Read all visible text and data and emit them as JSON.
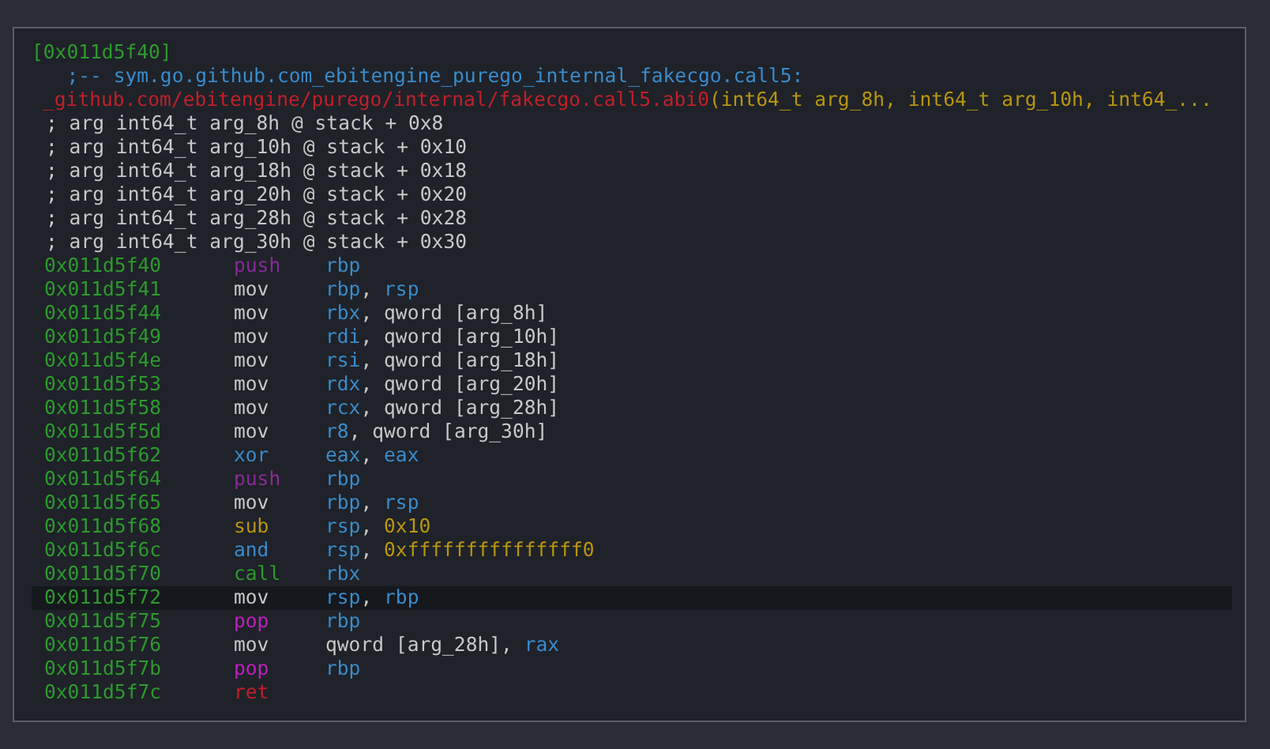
{
  "header": {
    "address": "[0x011d5f40]",
    "symbol_line": [
      {
        "text": "   ;-- sym.go.github.com_ebitengine_purego_internal_fakecgo.call5:",
        "kind": "flag"
      }
    ],
    "signature_line": [
      {
        "text": "_github.com/ebitengine/purego/internal/fakecgo.call5.abi0",
        "kind": "func"
      },
      {
        "text": "(int64_t arg_8h, int64_t arg_10h, int64_...",
        "kind": "args"
      }
    ]
  },
  "arg_comments": [
    "; arg int64_t arg_8h @ stack + 0x8",
    "; arg int64_t arg_10h @ stack + 0x10",
    "; arg int64_t arg_18h @ stack + 0x18",
    "; arg int64_t arg_20h @ stack + 0x20",
    "; arg int64_t arg_28h @ stack + 0x28",
    "; arg int64_t arg_30h @ stack + 0x30"
  ],
  "instructions": [
    {
      "address": "0x011d5f40",
      "mnemonic": "push",
      "kind": "push",
      "selected": false,
      "operands": [
        {
          "text": "rbp",
          "kind": "reg"
        }
      ]
    },
    {
      "address": "0x011d5f41",
      "mnemonic": "mov",
      "kind": "mov",
      "selected": false,
      "operands": [
        {
          "text": "rbp",
          "kind": "reg"
        },
        {
          "text": ", ",
          "kind": "plain"
        },
        {
          "text": "rsp",
          "kind": "reg"
        }
      ]
    },
    {
      "address": "0x011d5f44",
      "mnemonic": "mov",
      "kind": "mov",
      "selected": false,
      "operands": [
        {
          "text": "rbx",
          "kind": "reg"
        },
        {
          "text": ", qword [arg_8h]",
          "kind": "plain"
        }
      ]
    },
    {
      "address": "0x011d5f49",
      "mnemonic": "mov",
      "kind": "mov",
      "selected": false,
      "operands": [
        {
          "text": "rdi",
          "kind": "reg"
        },
        {
          "text": ", qword [arg_10h]",
          "kind": "plain"
        }
      ]
    },
    {
      "address": "0x011d5f4e",
      "mnemonic": "mov",
      "kind": "mov",
      "selected": false,
      "operands": [
        {
          "text": "rsi",
          "kind": "reg"
        },
        {
          "text": ", qword [arg_18h]",
          "kind": "plain"
        }
      ]
    },
    {
      "address": "0x011d5f53",
      "mnemonic": "mov",
      "kind": "mov",
      "selected": false,
      "operands": [
        {
          "text": "rdx",
          "kind": "reg"
        },
        {
          "text": ", qword [arg_20h]",
          "kind": "plain"
        }
      ]
    },
    {
      "address": "0x011d5f58",
      "mnemonic": "mov",
      "kind": "mov",
      "selected": false,
      "operands": [
        {
          "text": "rcx",
          "kind": "reg"
        },
        {
          "text": ", qword [arg_28h]",
          "kind": "plain"
        }
      ]
    },
    {
      "address": "0x011d5f5d",
      "mnemonic": "mov",
      "kind": "mov",
      "selected": false,
      "operands": [
        {
          "text": "r8",
          "kind": "reg"
        },
        {
          "text": ", qword [arg_30h]",
          "kind": "plain"
        }
      ]
    },
    {
      "address": "0x011d5f62",
      "mnemonic": "xor",
      "kind": "logic",
      "selected": false,
      "operands": [
        {
          "text": "eax",
          "kind": "reg"
        },
        {
          "text": ", ",
          "kind": "plain"
        },
        {
          "text": "eax",
          "kind": "reg"
        }
      ]
    },
    {
      "address": "0x011d5f64",
      "mnemonic": "push",
      "kind": "push",
      "selected": false,
      "operands": [
        {
          "text": "rbp",
          "kind": "reg"
        }
      ]
    },
    {
      "address": "0x011d5f65",
      "mnemonic": "mov",
      "kind": "mov",
      "selected": false,
      "operands": [
        {
          "text": "rbp",
          "kind": "reg"
        },
        {
          "text": ", ",
          "kind": "plain"
        },
        {
          "text": "rsp",
          "kind": "reg"
        }
      ]
    },
    {
      "address": "0x011d5f68",
      "mnemonic": "sub",
      "kind": "math",
      "selected": false,
      "operands": [
        {
          "text": "rsp",
          "kind": "reg"
        },
        {
          "text": ", ",
          "kind": "plain"
        },
        {
          "text": "0x10",
          "kind": "num"
        }
      ]
    },
    {
      "address": "0x011d5f6c",
      "mnemonic": "and",
      "kind": "logic",
      "selected": false,
      "operands": [
        {
          "text": "rsp",
          "kind": "reg"
        },
        {
          "text": ", ",
          "kind": "plain"
        },
        {
          "text": "0xfffffffffffffff0",
          "kind": "num"
        }
      ]
    },
    {
      "address": "0x011d5f70",
      "mnemonic": "call",
      "kind": "call",
      "selected": false,
      "operands": [
        {
          "text": "rbx",
          "kind": "reg"
        }
      ]
    },
    {
      "address": "0x011d5f72",
      "mnemonic": "mov",
      "kind": "mov",
      "selected": true,
      "operands": [
        {
          "text": "rsp",
          "kind": "reg"
        },
        {
          "text": ", ",
          "kind": "plain"
        },
        {
          "text": "rbp",
          "kind": "reg"
        }
      ]
    },
    {
      "address": "0x011d5f75",
      "mnemonic": "pop",
      "kind": "pop",
      "selected": false,
      "operands": [
        {
          "text": "rbp",
          "kind": "reg"
        }
      ]
    },
    {
      "address": "0x011d5f76",
      "mnemonic": "mov",
      "kind": "mov",
      "selected": false,
      "operands": [
        {
          "text": "qword [arg_28h], ",
          "kind": "plain"
        },
        {
          "text": "rax",
          "kind": "reg"
        }
      ]
    },
    {
      "address": "0x011d5f7b",
      "mnemonic": "pop",
      "kind": "pop",
      "selected": false,
      "operands": [
        {
          "text": "rbp",
          "kind": "reg"
        }
      ]
    },
    {
      "address": "0x011d5f7c",
      "mnemonic": "ret",
      "kind": "ret",
      "selected": false
    }
  ]
}
